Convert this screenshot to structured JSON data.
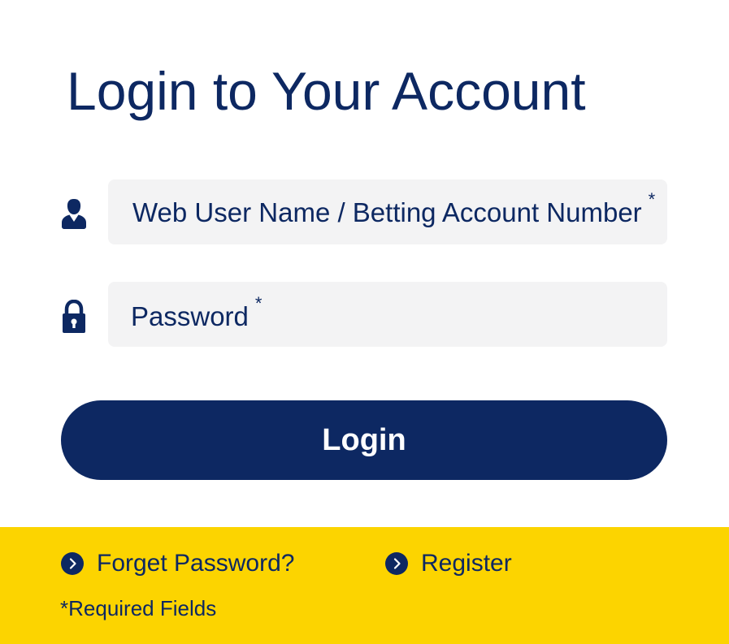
{
  "login_form": {
    "title": "Login to Your Account",
    "username_field": {
      "placeholder": "Web User Name / Betting Account Number",
      "required_marker": "*",
      "value": ""
    },
    "password_field": {
      "placeholder": "Password",
      "required_marker": "*",
      "value": ""
    },
    "login_button_label": "Login"
  },
  "footer": {
    "forget_password_label": "Forget Password?",
    "register_label": "Register",
    "required_note": "*Required Fields"
  },
  "colors": {
    "brand_navy": "#0d2862",
    "footer_yellow": "#fcd400",
    "field_background": "#f3f3f4",
    "page_background": "#ffffff"
  },
  "icons": {
    "username": "user-icon",
    "password": "lock-icon",
    "link_arrow": "chevron-right-circle-icon"
  }
}
